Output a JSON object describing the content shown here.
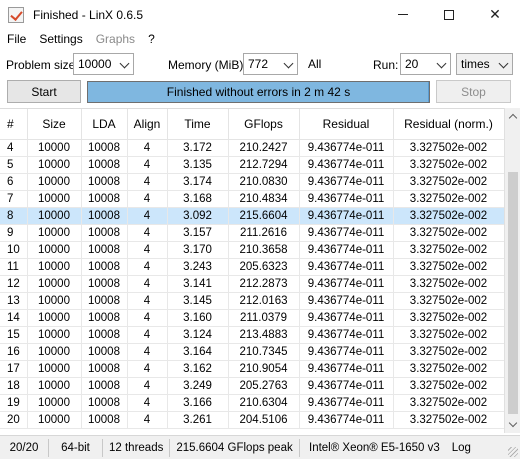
{
  "window": {
    "title": "Finished - LinX 0.6.5"
  },
  "menu": {
    "items": [
      "File",
      "Settings",
      "Graphs",
      "?"
    ]
  },
  "controls": {
    "problem_size_label": "Problem size:",
    "problem_size_value": "10000",
    "memory_label": "Memory (MiB):",
    "memory_value": "772",
    "all_label": "All",
    "run_label": "Run:",
    "run_value": "20",
    "run_unit": "times",
    "start_label": "Start",
    "stop_label": "Stop",
    "progress_text": "Finished without errors in 2 m 42 s",
    "progress_fraction": 1.0
  },
  "table": {
    "headers": [
      "#",
      "Size",
      "LDA",
      "Align",
      "Time",
      "GFlops",
      "Residual",
      "Residual (norm.)"
    ],
    "selected_row": 4,
    "rows": [
      [
        "4",
        "10000",
        "10008",
        "4",
        "3.172",
        "210.2427",
        "9.436774e-011",
        "3.327502e-002"
      ],
      [
        "5",
        "10000",
        "10008",
        "4",
        "3.135",
        "212.7294",
        "9.436774e-011",
        "3.327502e-002"
      ],
      [
        "6",
        "10000",
        "10008",
        "4",
        "3.174",
        "210.0830",
        "9.436774e-011",
        "3.327502e-002"
      ],
      [
        "7",
        "10000",
        "10008",
        "4",
        "3.168",
        "210.4834",
        "9.436774e-011",
        "3.327502e-002"
      ],
      [
        "8",
        "10000",
        "10008",
        "4",
        "3.092",
        "215.6604",
        "9.436774e-011",
        "3.327502e-002"
      ],
      [
        "9",
        "10000",
        "10008",
        "4",
        "3.157",
        "211.2616",
        "9.436774e-011",
        "3.327502e-002"
      ],
      [
        "10",
        "10000",
        "10008",
        "4",
        "3.170",
        "210.3658",
        "9.436774e-011",
        "3.327502e-002"
      ],
      [
        "11",
        "10000",
        "10008",
        "4",
        "3.243",
        "205.6323",
        "9.436774e-011",
        "3.327502e-002"
      ],
      [
        "12",
        "10000",
        "10008",
        "4",
        "3.141",
        "212.2873",
        "9.436774e-011",
        "3.327502e-002"
      ],
      [
        "13",
        "10000",
        "10008",
        "4",
        "3.145",
        "212.0163",
        "9.436774e-011",
        "3.327502e-002"
      ],
      [
        "14",
        "10000",
        "10008",
        "4",
        "3.160",
        "211.0379",
        "9.436774e-011",
        "3.327502e-002"
      ],
      [
        "15",
        "10000",
        "10008",
        "4",
        "3.124",
        "213.4883",
        "9.436774e-011",
        "3.327502e-002"
      ],
      [
        "16",
        "10000",
        "10008",
        "4",
        "3.164",
        "210.7345",
        "9.436774e-011",
        "3.327502e-002"
      ],
      [
        "17",
        "10000",
        "10008",
        "4",
        "3.162",
        "210.9054",
        "9.436774e-011",
        "3.327502e-002"
      ],
      [
        "18",
        "10000",
        "10008",
        "4",
        "3.249",
        "205.2763",
        "9.436774e-011",
        "3.327502e-002"
      ],
      [
        "19",
        "10000",
        "10008",
        "4",
        "3.166",
        "210.6304",
        "9.436774e-011",
        "3.327502e-002"
      ],
      [
        "20",
        "10000",
        "10008",
        "4",
        "3.261",
        "204.5106",
        "9.436774e-011",
        "3.327502e-002"
      ]
    ]
  },
  "status": {
    "runs": "20/20",
    "bits": "64-bit",
    "threads": "12 threads",
    "peak": "215.6604 GFlops peak",
    "cpu": "Intel® Xeon® E5-1650 v3",
    "trailing": "Log"
  },
  "colors": {
    "selection": "#cce6fb",
    "progress": "#7fb7e0"
  }
}
